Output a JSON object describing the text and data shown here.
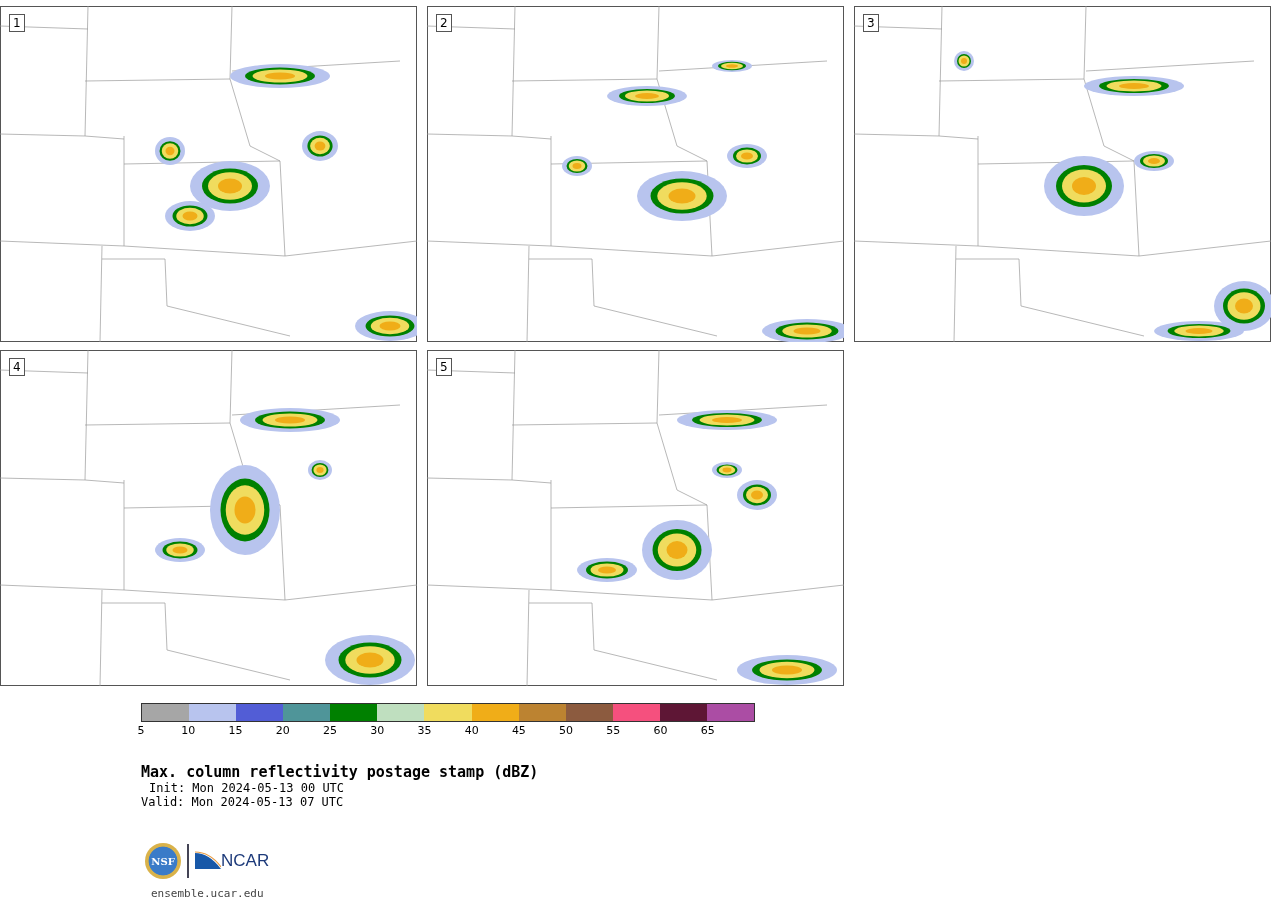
{
  "panels": [
    {
      "label": "1"
    },
    {
      "label": "2"
    },
    {
      "label": "3"
    },
    {
      "label": "4"
    },
    {
      "label": "5"
    }
  ],
  "colorbar": {
    "bins": [
      {
        "color": "#a6a6a6"
      },
      {
        "color": "#b8c4ee"
      },
      {
        "color": "#525dd6"
      },
      {
        "color": "#4f9599"
      },
      {
        "color": "#008000"
      },
      {
        "color": "#bfdfbf"
      },
      {
        "color": "#f0dc5e"
      },
      {
        "color": "#f0ad18"
      },
      {
        "color": "#bc8331"
      },
      {
        "color": "#8c5b3f"
      },
      {
        "color": "#f5507e"
      },
      {
        "color": "#5e1635"
      },
      {
        "color": "#ab4da4"
      }
    ],
    "ticks": [
      "5",
      "10",
      "15",
      "20",
      "25",
      "30",
      "35",
      "40",
      "45",
      "50",
      "55",
      "60",
      "65"
    ]
  },
  "title": "Max. column reflectivity postage stamp (dBZ)",
  "init": "Init: Mon 2024-05-13 00 UTC",
  "valid": "Valid: Mon 2024-05-13 07 UTC",
  "logos": {
    "nsf": "NSF",
    "ncar": "NCAR"
  },
  "url": "ensemble.ucar.edu"
}
